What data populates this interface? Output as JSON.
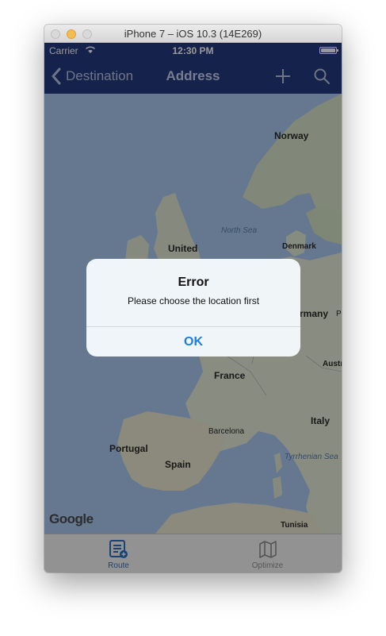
{
  "window": {
    "title": "iPhone 7 – iOS 10.3 (14E269)"
  },
  "status_bar": {
    "carrier": "Carrier",
    "time": "12:30 PM"
  },
  "nav": {
    "back_label": "Destination",
    "title": "Address",
    "add_icon": "plus-icon",
    "search_icon": "search-icon"
  },
  "map": {
    "labels": {
      "norway": "Norway",
      "north_sea": "North Sea",
      "denmark": "Denmark",
      "united": "United",
      "germany": "rmany",
      "p": "P",
      "france": "France",
      "austria": "Austr",
      "italy": "Italy",
      "barcelona": "Barcelona",
      "portugal": "Portugal",
      "spain": "Spain",
      "tyrrhenian": "Tyrrhenian Sea",
      "tunisia": "Tunisia"
    },
    "logo_text": "Google"
  },
  "alert": {
    "title": "Error",
    "message": "Please choose the location first",
    "ok_label": "OK"
  },
  "tabs": [
    {
      "label": "Route",
      "icon": "route-icon",
      "selected": true
    },
    {
      "label": "Optimize",
      "icon": "map-icon",
      "selected": false
    }
  ],
  "colors": {
    "nav_bar": "#233a7e",
    "accent": "#1a7de6",
    "water": "#a9c9ee",
    "land": "#dfe6d3"
  }
}
